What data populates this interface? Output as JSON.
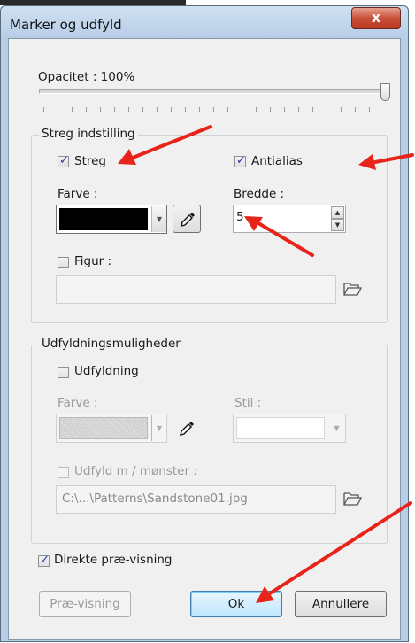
{
  "window": {
    "title": "Marker og udfyld",
    "close_label": "x"
  },
  "opacity": {
    "label": "Opacitet : 100%",
    "value_percent": 100
  },
  "stroke_group": {
    "title": "Streg indstilling",
    "stroke_label": "Streg",
    "stroke_checked": true,
    "antialias_label": "Antialias",
    "antialias_checked": true,
    "color_label": "Farve :",
    "color_value": "#000000",
    "width_label": "Bredde :",
    "width_value": "5",
    "figure_label": "Figur :",
    "figure_checked": false,
    "figure_path": ""
  },
  "fill_group": {
    "title": "Udfyldningsmuligheder",
    "fill_label": "Udfyldning",
    "fill_checked": false,
    "color_label": "Farve :",
    "style_label": "Stil :",
    "pattern_label": "Udfyld m / mønster :",
    "pattern_checked": false,
    "pattern_path": "C:\\...\\Patterns\\Sandstone01.jpg"
  },
  "direct_preview": {
    "label": "Direkte præ-visning",
    "checked": true
  },
  "buttons": {
    "preview": "Præ-visning",
    "ok": "Ok",
    "cancel": "Annullere"
  },
  "icons": {
    "picker": "eyedropper-icon",
    "folder": "folder-open-icon",
    "arrows": "red-annotation-arrow"
  },
  "colors": {
    "annotation": "#e8231a",
    "title_bar": "#b9cfe6",
    "close": "#c9513a"
  }
}
